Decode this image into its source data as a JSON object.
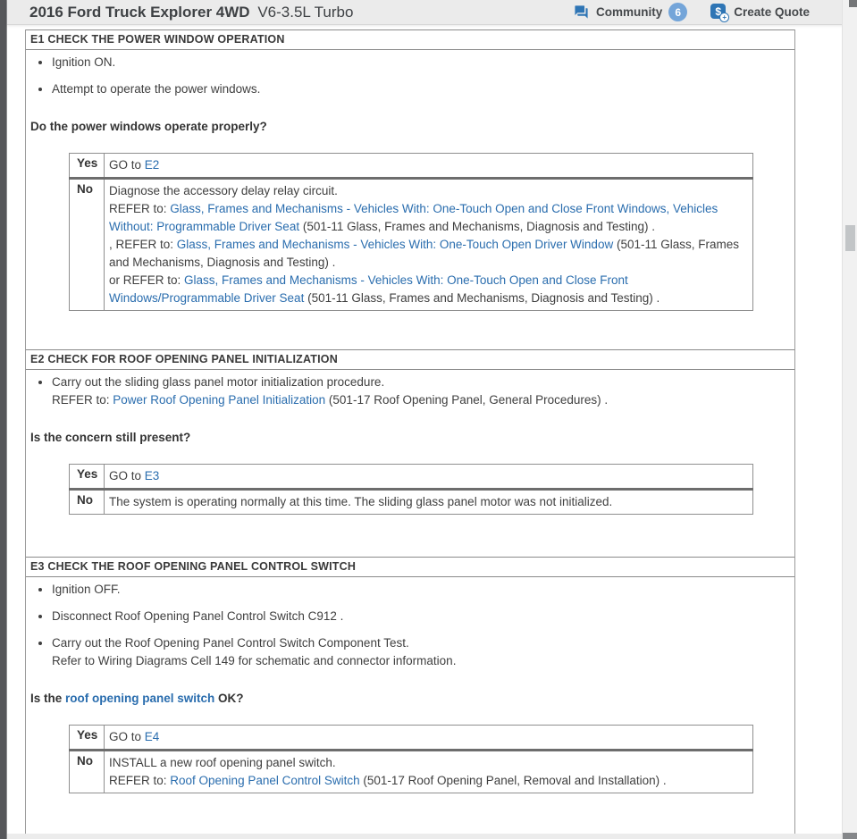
{
  "header": {
    "title_bold": "2016 Ford Truck Explorer 4WD",
    "title_engine": "V6-3.5L Turbo",
    "community_label": "Community",
    "community_count": "6",
    "create_quote_label": "Create Quote",
    "quote_icon_glyph": "$",
    "quote_icon_plus": "+"
  },
  "colors": {
    "accent_blue": "#2e75b5",
    "badge_blue": "#74a5d9",
    "link_blue": "#2a6dae",
    "header_bg": "#ebebeb",
    "border_gray": "#8f8f8f"
  },
  "sections": [
    {
      "id": "E1",
      "title": "E1 CHECK THE POWER WINDOW OPERATION",
      "bullets": [
        {
          "lines": [
            [
              {
                "t": "Ignition ON."
              }
            ]
          ]
        },
        {
          "lines": [
            [
              {
                "t": "Attempt to operate the power windows."
              }
            ]
          ]
        }
      ],
      "question": [
        {
          "t": "Do the power windows operate properly?"
        }
      ],
      "table": [
        {
          "answer": "Yes",
          "lines": [
            [
              {
                "t": "GO to "
              },
              {
                "t": "E2",
                "link": true,
                "name": "goto-link"
              }
            ]
          ]
        },
        {
          "answer": "No",
          "lines": [
            [
              {
                "t": "Diagnose the accessory delay relay circuit."
              }
            ],
            [
              {
                "t": "REFER to: "
              },
              {
                "t": "Glass, Frames and Mechanisms - Vehicles With: One-Touch Open and Close Front Windows, Vehicles Without: Programmable Driver Seat",
                "link": true
              },
              {
                "t": " (501-11 Glass, Frames and Mechanisms, Diagnosis and Testing) ."
              }
            ],
            [
              {
                "t": ", REFER to: "
              },
              {
                "t": "Glass, Frames and Mechanisms - Vehicles With: One-Touch Open Driver Window",
                "link": true
              },
              {
                "t": " (501-11 Glass, Frames and Mechanisms, Diagnosis and Testing) ."
              }
            ],
            [
              {
                "t": "or REFER to: "
              },
              {
                "t": "Glass, Frames and Mechanisms - Vehicles With: One-Touch Open and Close Front Windows/Programmable Driver Seat",
                "link": true
              },
              {
                "t": " (501-11 Glass, Frames and Mechanisms, Diagnosis and Testing) ."
              }
            ]
          ]
        }
      ],
      "gap_after": 43
    },
    {
      "id": "E2",
      "title": "E2 CHECK FOR ROOF OPENING PANEL INITIALIZATION",
      "bullets": [
        {
          "lines": [
            [
              {
                "t": "Carry out the sliding glass panel motor initialization procedure."
              }
            ],
            [
              {
                "t": "REFER to: "
              },
              {
                "t": "Power Roof Opening Panel Initialization",
                "link": true
              },
              {
                "t": " (501-17 Roof Opening Panel, General Procedures) ."
              }
            ]
          ]
        }
      ],
      "question": [
        {
          "t": "Is the concern still present?"
        }
      ],
      "table": [
        {
          "answer": "Yes",
          "lines": [
            [
              {
                "t": "GO to "
              },
              {
                "t": "E3",
                "link": true,
                "name": "goto-link"
              }
            ]
          ]
        },
        {
          "answer": "No",
          "lines": [
            [
              {
                "t": "The system is operating normally at this time. The sliding glass panel motor was not initialized."
              }
            ]
          ]
        }
      ],
      "gap_after": 47
    },
    {
      "id": "E3",
      "title": "E3 CHECK THE ROOF OPENING PANEL CONTROL SWITCH",
      "bullets": [
        {
          "lines": [
            [
              {
                "t": "Ignition OFF."
              }
            ]
          ]
        },
        {
          "lines": [
            [
              {
                "t": "Disconnect Roof Opening Panel Control Switch C912 ."
              }
            ]
          ]
        },
        {
          "lines": [
            [
              {
                "t": "Carry out the Roof Opening Panel Control Switch Component Test."
              }
            ],
            [
              {
                "t": "Refer to Wiring Diagrams Cell 149 for schematic and connector information."
              }
            ]
          ]
        }
      ],
      "question": [
        {
          "t": "Is the "
        },
        {
          "t": "roof opening panel switch",
          "link": true
        },
        {
          "t": " OK?"
        }
      ],
      "table": [
        {
          "answer": "Yes",
          "lines": [
            [
              {
                "t": "GO to "
              },
              {
                "t": "E4",
                "link": true,
                "name": "goto-link"
              }
            ]
          ]
        },
        {
          "answer": "No",
          "lines": [
            [
              {
                "t": "INSTALL a new roof opening panel switch."
              }
            ],
            [
              {
                "t": "REFER to: "
              },
              {
                "t": "Roof Opening Panel Control Switch",
                "link": true
              },
              {
                "t": " (501-17 Roof Opening Panel, Removal and Installation) ."
              }
            ]
          ]
        }
      ],
      "gap_after": 0
    }
  ]
}
